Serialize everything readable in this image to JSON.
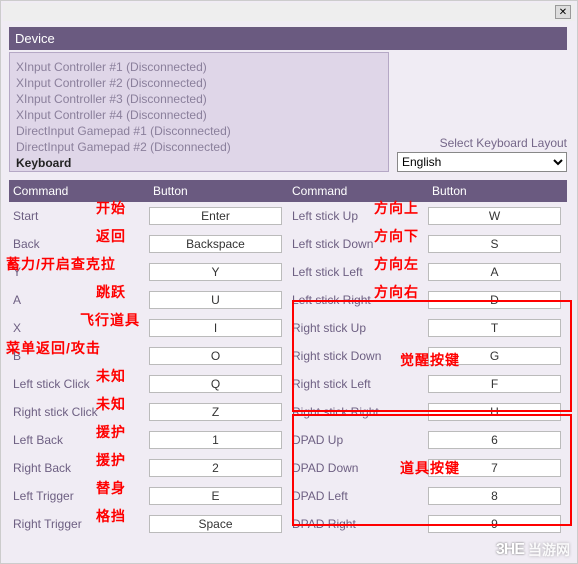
{
  "window": {
    "close_icon": "✕"
  },
  "section_title": "Device",
  "devices": [
    "XInput Controller #1 (Disconnected)",
    "XInput Controller #2 (Disconnected)",
    "XInput Controller #3 (Disconnected)",
    "XInput Controller #4 (Disconnected)",
    "DirectInput Gamepad #1 (Disconnected)",
    "DirectInput Gamepad #2 (Disconnected)",
    "Keyboard"
  ],
  "device_selected_index": 6,
  "layout": {
    "label": "Select Keyboard Layout",
    "value": "English"
  },
  "headers": {
    "command": "Command",
    "button": "Button"
  },
  "left_rows": [
    {
      "cmd": "Start",
      "btn": "Enter"
    },
    {
      "cmd": "Back",
      "btn": "Backspace"
    },
    {
      "cmd": "Y",
      "btn": "Y"
    },
    {
      "cmd": "A",
      "btn": "U"
    },
    {
      "cmd": "X",
      "btn": "I"
    },
    {
      "cmd": "B",
      "btn": "O"
    },
    {
      "cmd": "Left stick Click",
      "btn": "Q"
    },
    {
      "cmd": "Right stick Click",
      "btn": "Z"
    },
    {
      "cmd": "Left Back",
      "btn": "1"
    },
    {
      "cmd": "Right Back",
      "btn": "2"
    },
    {
      "cmd": "Left Trigger",
      "btn": "E"
    },
    {
      "cmd": "Right Trigger",
      "btn": "Space"
    }
  ],
  "right_rows": [
    {
      "cmd": "Left stick Up",
      "btn": "W"
    },
    {
      "cmd": "Left stick Down",
      "btn": "S"
    },
    {
      "cmd": "Left stick Left",
      "btn": "A"
    },
    {
      "cmd": "Left stick Right",
      "btn": "D"
    },
    {
      "cmd": "Right stick Up",
      "btn": "T"
    },
    {
      "cmd": "Right stick Down",
      "btn": "G"
    },
    {
      "cmd": "Right stick Left",
      "btn": "F"
    },
    {
      "cmd": "Right stick Right",
      "btn": "H"
    },
    {
      "cmd": "DPAD Up",
      "btn": "6"
    },
    {
      "cmd": "DPAD Down",
      "btn": "7"
    },
    {
      "cmd": "DPAD Left",
      "btn": "8"
    },
    {
      "cmd": "DPAD Right",
      "btn": "9"
    }
  ],
  "annotations": {
    "left": [
      "开始",
      "返回",
      "蓄力/开启查克拉",
      "跳跃",
      "飞行道具",
      "菜单返回/攻击",
      "未知",
      "未知",
      "援护",
      "援护",
      "替身",
      "格挡"
    ],
    "right_top": [
      "方向上",
      "方向下",
      "方向左",
      "方向右"
    ],
    "group1": "觉醒按键",
    "group2": "道具按键"
  },
  "watermark": {
    "logo": "3HE",
    "text": "当游网"
  }
}
